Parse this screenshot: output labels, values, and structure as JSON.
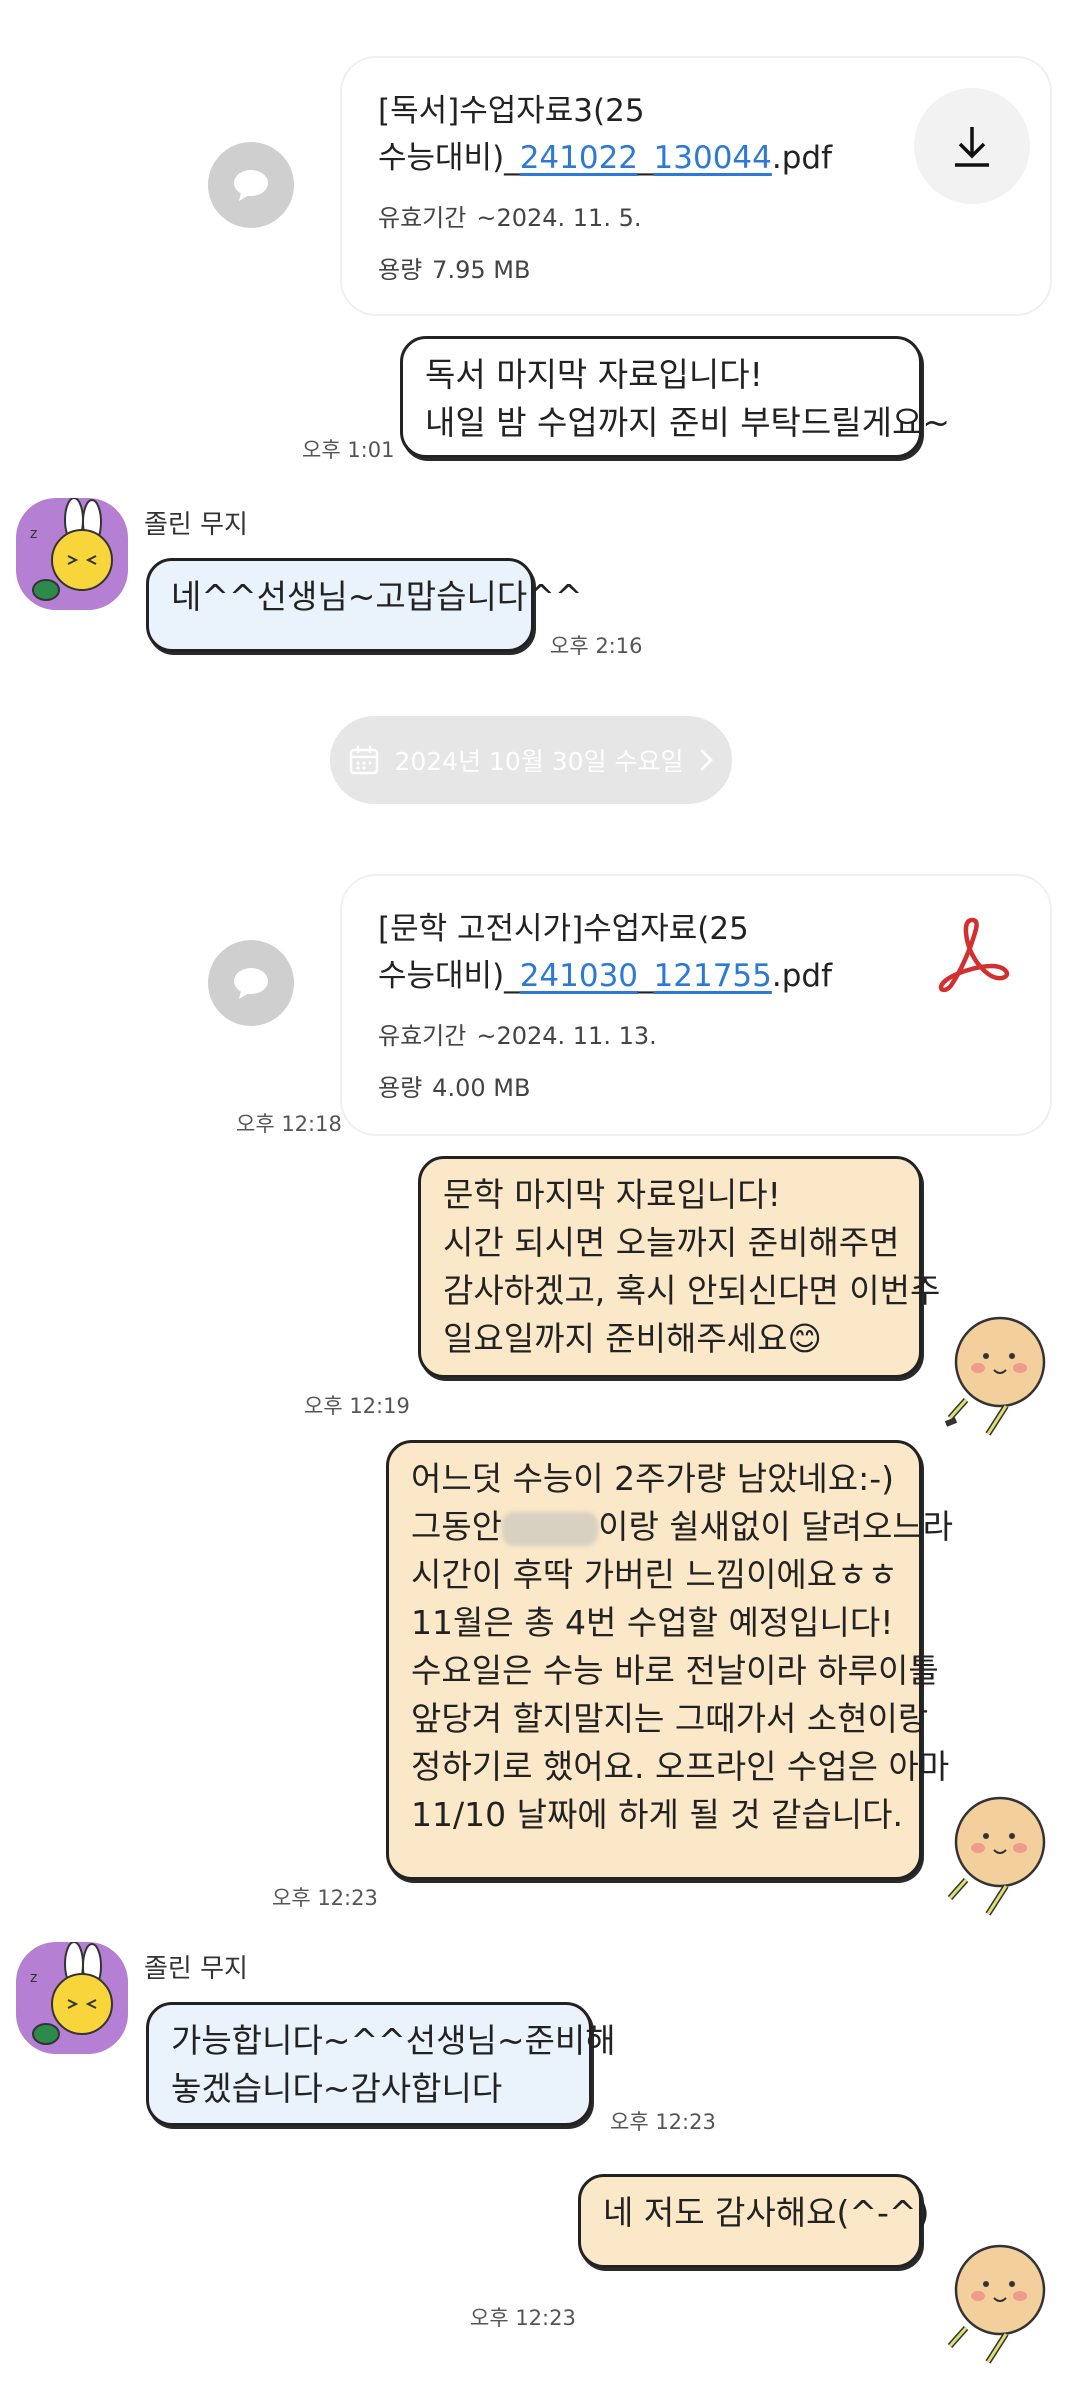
{
  "messages": {
    "file1": {
      "name_prefix": "[독서]수업자료3(25",
      "name_line2_prefix": "수능대비)_",
      "name_link1": "241022",
      "name_sep": "_",
      "name_link2": "130044",
      "name_ext": ".pdf",
      "expiry_label": "유효기간",
      "expiry_value": "~2024. 11. 5.",
      "size_label": "용량",
      "size_value": "7.95 MB",
      "icon": "download-icon"
    },
    "msg1": {
      "lines": [
        "독서 마지막 자료입니다!",
        "내일 밤 수업까지 준비 부탁드릴게요~"
      ],
      "time": "오후 1:01"
    },
    "sender1": {
      "name": "졸린 무지"
    },
    "msg2": {
      "text": "네^^선생님~고맙습니다^^",
      "time": "오후 2:16"
    },
    "date_divider": {
      "text": "2024년 10월 30일 수요일",
      "icon": "calendar-icon"
    },
    "file2": {
      "name_prefix": "[문학 고전시가]수업자료(25",
      "name_line2_prefix": "수능대비)_",
      "name_link1": "241030",
      "name_sep": "_",
      "name_link2": "121755",
      "name_ext": ".pdf",
      "expiry_label": "유효기간",
      "expiry_value": "~2024. 11. 13.",
      "size_label": "용량",
      "size_value": "4.00 MB",
      "time": "오후 12:18",
      "icon": "pdf-icon"
    },
    "msg3": {
      "lines": [
        "문학 마지막 자료입니다!",
        "시간 되시면 오늘까지 준비해주면",
        "감사하겠고, 혹시 안되신다면 이번주",
        "일요일까지 준비해주세요😊"
      ],
      "time": "오후 12:19"
    },
    "msg4": {
      "line1": "어느덧 수능이 2주가량 남았네요:-)",
      "line2_prefix": "그동안",
      "line2_suffix": "이랑 쉴새없이 달려오느라",
      "lines_rest": [
        "시간이 후딱 가버린 느낌이에요ㅎㅎ",
        "11월은 총 4번 수업할 예정입니다!",
        "수요일은 수능 바로 전날이라 하루이틀",
        "앞당겨 할지말지는 그때가서 소현이랑",
        "정하기로 했어요. 오프라인 수업은 아마",
        "11/10 날짜에 하게 될 것 같습니다."
      ],
      "time": "오후 12:23"
    },
    "sender2": {
      "name": "졸린 무지"
    },
    "msg5": {
      "lines": [
        "가능합니다~^^선생님~준비해",
        "놓겠습니다~감사합니다"
      ],
      "time": "오후 12:23"
    },
    "msg6": {
      "text": "네 저도 감사해요(^-^)",
      "time": "오후 12:23"
    }
  },
  "colors": {
    "link": "#2c79d6",
    "bubble_blue": "#eaf2fc",
    "bubble_beige": "#fbe8c8",
    "avatar_bg": "#b57fd4",
    "pdf_red": "#d32f2f"
  }
}
